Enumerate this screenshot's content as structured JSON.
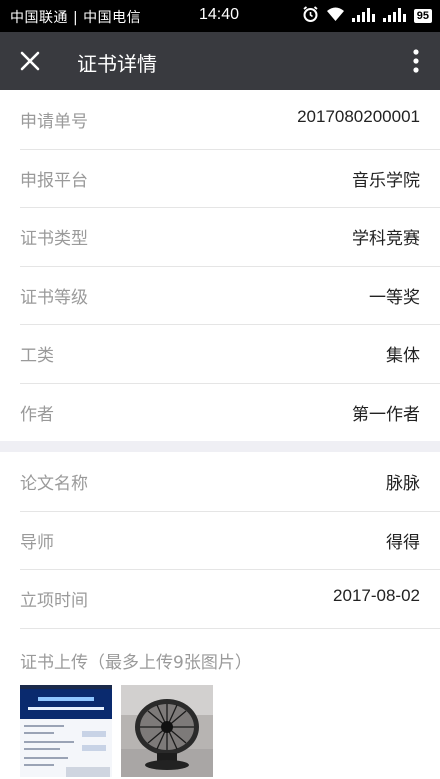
{
  "statusbar": {
    "carrier": "中国联通 | 中国电信",
    "time": "14:40",
    "battery": "95",
    "icons": [
      "alarm-icon",
      "wifi-icon",
      "signal-icon",
      "signal-icon",
      "battery-icon"
    ]
  },
  "header": {
    "title": "证书详情",
    "close_icon": "close-icon",
    "more_icon": "more-vertical-icon"
  },
  "details_group1": [
    {
      "label": "申请单号",
      "value": "2017080200001"
    },
    {
      "label": "申报平台",
      "value": "音乐学院"
    },
    {
      "label": "证书类型",
      "value": "学科竞赛"
    },
    {
      "label": "证书等级",
      "value": "一等奖"
    },
    {
      "label": "工类",
      "value": "集体"
    },
    {
      "label": "作者",
      "value": "第一作者"
    }
  ],
  "details_group2": [
    {
      "label": "论文名称",
      "value": "脉脉"
    },
    {
      "label": "导师",
      "value": "得得"
    },
    {
      "label": "立项时间",
      "value": "2017-08-02"
    }
  ],
  "upload": {
    "label": "证书上传（最多上传9张图片）",
    "images": [
      "certificate-photo-1",
      "certificate-photo-2"
    ]
  },
  "colors": {
    "statusbar": "#000000",
    "actionbar": "#393a3f",
    "label": "#9a9a9a",
    "background": "#efeff4"
  }
}
